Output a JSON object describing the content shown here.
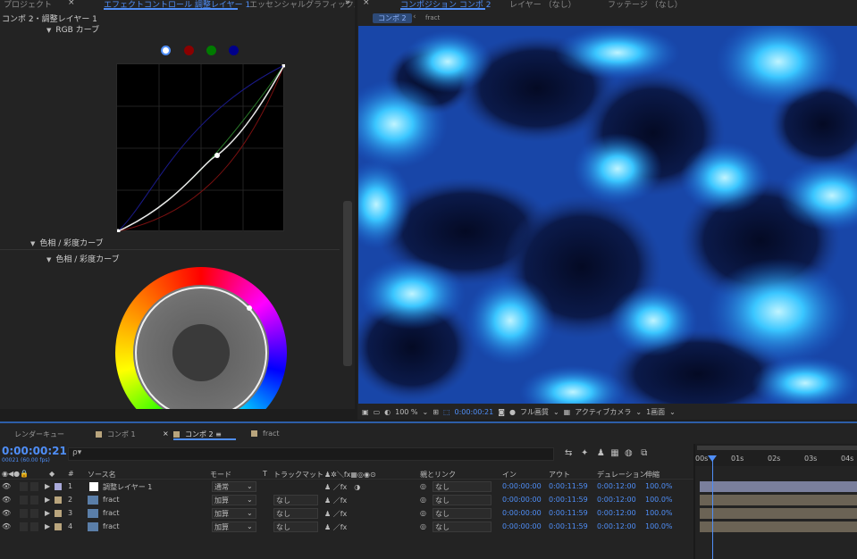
{
  "left_panel": {
    "tabs": [
      "プロジェクト",
      "エフェクトコントロール 調整レイヤー 1",
      "エッセンシャルグラフィックス"
    ],
    "layer_path": "コンポ 2・調整レイヤー 1",
    "rgb_curves_label": "RGB カーブ",
    "hue_sat_outer_label": "色相 / 彩度カーブ",
    "hue_sat_inner_label": "色相 / 彩度カーブ",
    "channel_colors": [
      "#ffffff",
      "#c00000",
      "#00a000",
      "#0000c0"
    ]
  },
  "viewer": {
    "tabs": [
      "コンポジション コンポ 2",
      "レイヤー （なし）",
      "フッテージ （なし）"
    ],
    "breadcrumb_comp": "コンポ 2",
    "breadcrumb_layer": "fract",
    "zoom": "100 %",
    "timecode": "0:00:00:21",
    "resolution": "フル画質",
    "camera": "アクティブカメラ",
    "views": "1画面"
  },
  "timeline": {
    "tabs": [
      {
        "label": "レンダーキュー",
        "color": ""
      },
      {
        "label": "コンポ 1",
        "color": "#b9a57d"
      },
      {
        "label": "コンポ 2",
        "color": "#b9a57d"
      },
      {
        "label": "fract",
        "color": "#b9a57d"
      }
    ],
    "timecode": "0:00:00:21",
    "fps_label": "00021 (60.00 fps)",
    "search_placeholder": "ρ▾",
    "headers": {
      "num": "#",
      "source": "ソース名",
      "mode": "モード",
      "t": "T",
      "track_matte": "トラックマット",
      "parent": "親とリンク",
      "in": "イン",
      "out": "アウト",
      "duration": "デュレーション",
      "stretch": "伸縮"
    },
    "layers": [
      {
        "num": "1",
        "name": "調整レイヤー 1",
        "mode": "通常",
        "matte": "",
        "parent": "なし",
        "in": "0:00:00:00",
        "out": "0:00:11:59",
        "dur": "0:00:12:00",
        "stretch": "100.0%",
        "label": "#a9a9d9"
      },
      {
        "num": "2",
        "name": "fract",
        "mode": "加算",
        "matte": "なし",
        "parent": "なし",
        "in": "0:00:00:00",
        "out": "0:00:11:59",
        "dur": "0:00:12:00",
        "stretch": "100.0%",
        "label": "#b9a57d"
      },
      {
        "num": "3",
        "name": "fract",
        "mode": "加算",
        "matte": "なし",
        "parent": "なし",
        "in": "0:00:00:00",
        "out": "0:00:11:59",
        "dur": "0:00:12:00",
        "stretch": "100.0%",
        "label": "#b9a57d"
      },
      {
        "num": "4",
        "name": "fract",
        "mode": "加算",
        "matte": "なし",
        "parent": "なし",
        "in": "0:00:00:00",
        "out": "0:00:11:59",
        "dur": "0:00:12:00",
        "stretch": "100.0%",
        "label": "#b9a57d"
      }
    ],
    "ruler_labels": [
      "00s",
      "01s",
      "02s",
      "03s",
      "04s"
    ]
  }
}
